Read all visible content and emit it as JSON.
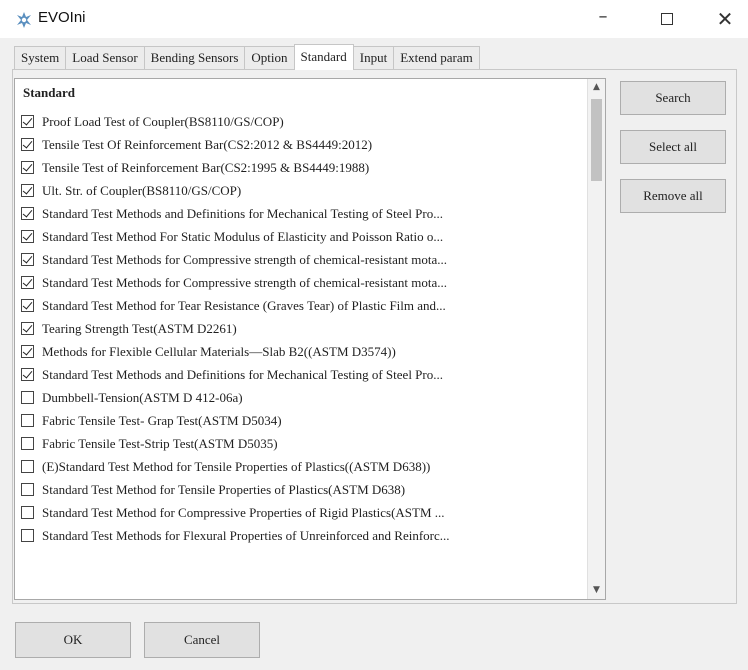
{
  "window": {
    "title": "EVOIni",
    "minimize_glyph": "–",
    "close_glyph": "✕"
  },
  "tabs": [
    {
      "label": "System",
      "active": false
    },
    {
      "label": "Load Sensor",
      "active": false
    },
    {
      "label": "Bending Sensors",
      "active": false
    },
    {
      "label": "Option",
      "active": false
    },
    {
      "label": "Standard",
      "active": true
    },
    {
      "label": "Input",
      "active": false
    },
    {
      "label": "Extend param",
      "active": false
    }
  ],
  "list": {
    "header": "Standard",
    "items": [
      {
        "label": "Proof Load Test of Coupler(BS8110/GS/COP)",
        "checked": true
      },
      {
        "label": "Tensile Test Of Reinforcement Bar(CS2:2012 & BS4449:2012)",
        "checked": true
      },
      {
        "label": "Tensile Test of Reinforcement Bar(CS2:1995 & BS4449:1988)",
        "checked": true
      },
      {
        "label": "Ult. Str. of Coupler(BS8110/GS/COP)",
        "checked": true
      },
      {
        "label": "Standard Test Methods and Definitions for Mechanical Testing of Steel Pro...",
        "checked": true
      },
      {
        "label": "Standard Test Method For Static Modulus of Elasticity and Poisson Ratio o...",
        "checked": true
      },
      {
        "label": "Standard Test Methods for Compressive strength of chemical-resistant mota...",
        "checked": true
      },
      {
        "label": "Standard Test Methods for Compressive strength of chemical-resistant mota...",
        "checked": true
      },
      {
        "label": "Standard Test Method for Tear Resistance (Graves Tear) of Plastic Film and...",
        "checked": true
      },
      {
        "label": "Tearing Strength Test(ASTM D2261)",
        "checked": true
      },
      {
        "label": "Methods for Flexible Cellular Materials—Slab B2((ASTM D3574))",
        "checked": true
      },
      {
        "label": "Standard Test Methods and Definitions for Mechanical Testing of Steel Pro...",
        "checked": true
      },
      {
        "label": "Dumbbell-Tension(ASTM D 412-06a)",
        "checked": false
      },
      {
        "label": "Fabric Tensile Test- Grap Test(ASTM D5034)",
        "checked": false
      },
      {
        "label": "Fabric Tensile Test-Strip Test(ASTM D5035)",
        "checked": false
      },
      {
        "label": "(E)Standard Test Method for Tensile Properties of Plastics((ASTM D638))",
        "checked": false
      },
      {
        "label": "Standard Test Method for Tensile Properties of Plastics(ASTM D638)",
        "checked": false
      },
      {
        "label": "Standard Test Method for Compressive Properties of Rigid Plastics(ASTM ...",
        "checked": false
      },
      {
        "label": "Standard Test Methods for Flexural Properties of Unreinforced and Reinforc...",
        "checked": false
      }
    ]
  },
  "buttons": {
    "search": "Search",
    "select_all": "Select all",
    "remove_all": "Remove all",
    "ok": "OK",
    "cancel": "Cancel"
  },
  "icons": {
    "app": "evo-app-icon",
    "minimize": "minimize-icon",
    "maximize": "maximize-icon",
    "close": "close-icon",
    "scroll_up": "scroll-up-icon",
    "scroll_down": "scroll-down-icon"
  },
  "colors": {
    "window_bg": "#f0f0f0",
    "list_bg": "#ffffff",
    "button_bg": "#e1e1e1",
    "app_icon": "#5a8fbf"
  }
}
